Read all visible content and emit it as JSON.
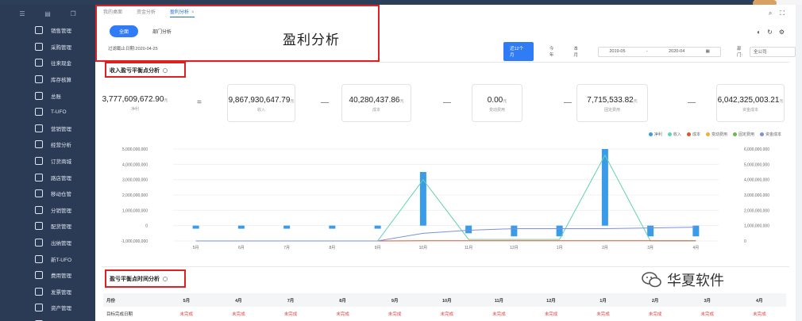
{
  "sidebar": {
    "items": [
      {
        "label": "销售管理"
      },
      {
        "label": "采购管理"
      },
      {
        "label": "往来现金"
      },
      {
        "label": "库存核算"
      },
      {
        "label": "总账"
      },
      {
        "label": "T-UFO"
      },
      {
        "label": "营销管理"
      },
      {
        "label": "经营分析"
      },
      {
        "label": "订货商城"
      },
      {
        "label": "路店管理"
      },
      {
        "label": "移动仓管"
      },
      {
        "label": "分销管理"
      },
      {
        "label": "配货管理"
      },
      {
        "label": "出纳管理"
      },
      {
        "label": "新T-UFO"
      },
      {
        "label": "费用管理"
      },
      {
        "label": "发票管理"
      },
      {
        "label": "资产管理"
      },
      {
        "label": "报表中心"
      }
    ]
  },
  "tabs": [
    {
      "label": "我的桌面"
    },
    {
      "label": "资金分析"
    },
    {
      "label": "盈利分析"
    }
  ],
  "header": {
    "big_title": "盈利分析",
    "pill_company": "全面",
    "pill_dept": "部门分析",
    "deadline": "过滤截止日期:2020-04-25"
  },
  "filters": {
    "recent12": "近12个月",
    "this_year": "今年",
    "this_month": "本月",
    "date_from": "2019-05",
    "date_to": "2020-04",
    "dept_label": "部门:",
    "dept_value": "全公司"
  },
  "section1": {
    "title": "收入盈亏平衡点分析"
  },
  "metrics": [
    {
      "value": "3,777,609,672.90",
      "unit": "元",
      "label": "净利"
    },
    {
      "value": "9,867,930,647.79",
      "unit": "元",
      "label": "收入"
    },
    {
      "value": "40,280,437.86",
      "unit": "元",
      "label": "成本"
    },
    {
      "value": "0.00",
      "unit": "元",
      "label": "变动费用"
    },
    {
      "value": "7,715,533.82",
      "unit": "元",
      "label": "固定费用"
    },
    {
      "value": "6,042,325,003.21",
      "unit": "元",
      "label": "资金成本"
    }
  ],
  "operators": [
    "=",
    "—",
    "—",
    "—",
    "—"
  ],
  "legend": [
    {
      "name": "净利",
      "color": "#3a9be8"
    },
    {
      "name": "收入",
      "color": "#5fd3b3"
    },
    {
      "name": "成本",
      "color": "#e0542a"
    },
    {
      "name": "变动费用",
      "color": "#f0b030"
    },
    {
      "name": "固定费用",
      "color": "#6cb84a"
    },
    {
      "name": "资金成本",
      "color": "#7d8fe0"
    }
  ],
  "chart_data": {
    "type": "bar",
    "categories": [
      "5月",
      "6月",
      "7月",
      "8月",
      "9月",
      "10月",
      "11月",
      "12月",
      "1月",
      "2月",
      "3月",
      "4月"
    ],
    "yticks_left": [
      "5,000,000,000",
      "4,000,000,000",
      "3,000,000,000",
      "2,000,000,000",
      "1,000,000,000",
      "0",
      "-1,000,000,000"
    ],
    "yticks_right": [
      "6,000,000,000",
      "5,000,000,000",
      "4,000,000,000",
      "3,000,000,000",
      "2,000,000,000",
      "1,000,000,000",
      "0"
    ],
    "ylim_left": [
      -1000000000,
      5000000000
    ],
    "ylim_right": [
      0,
      6000000000
    ],
    "series": [
      {
        "name": "净利",
        "type": "bar",
        "axis": "left",
        "values": [
          -200000000,
          -200000000,
          -200000000,
          -200000000,
          -200000000,
          3500000000,
          -500000000,
          -700000000,
          -700000000,
          5000000000,
          -700000000,
          -700000000
        ]
      },
      {
        "name": "收入",
        "type": "line",
        "axis": "right",
        "values": [
          0,
          0,
          0,
          0,
          0,
          4000000000,
          100000000,
          100000000,
          100000000,
          5600000000,
          0,
          0
        ]
      },
      {
        "name": "成本",
        "type": "line",
        "axis": "right",
        "values": [
          0,
          0,
          0,
          0,
          0,
          10000000,
          10000000,
          10000000,
          10000000,
          10000000,
          10000000,
          10000000
        ]
      },
      {
        "name": "资金成本",
        "type": "line",
        "axis": "right",
        "values": [
          0,
          0,
          0,
          0,
          0,
          500000000,
          700000000,
          800000000,
          800000000,
          800000000,
          850000000,
          900000000
        ]
      }
    ]
  },
  "section2": {
    "title": "盈亏平衡点时间分析"
  },
  "table": {
    "headers": [
      "月份",
      "5月",
      "4月",
      "7月",
      "8月",
      "9月",
      "10月",
      "11月",
      "12月",
      "1月",
      "2月",
      "3月",
      "4月"
    ],
    "row": [
      "目标完成日期",
      "未完成",
      "未完成",
      "未完成",
      "未完成",
      "未完成",
      "未完成",
      "未完成",
      "未完成",
      "未完成",
      "未完成",
      "未完成",
      "未完成"
    ]
  },
  "watermark": {
    "text": "华夏软件"
  }
}
